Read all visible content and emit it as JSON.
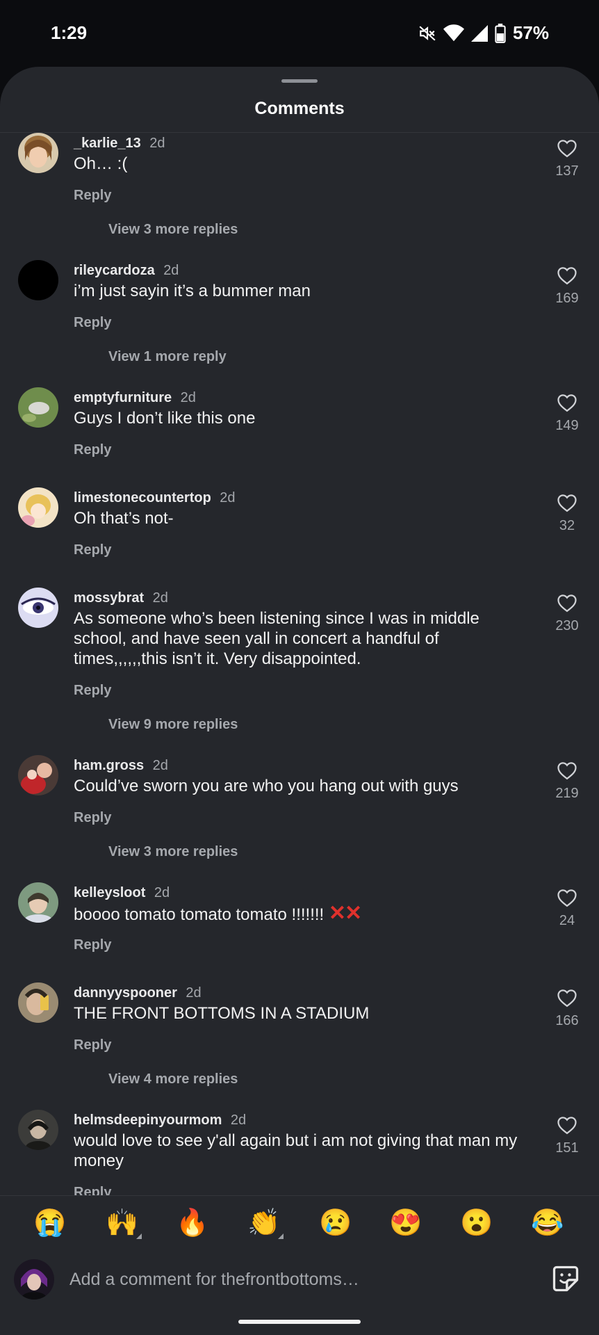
{
  "status_bar": {
    "time": "1:29",
    "battery": "57%"
  },
  "sheet": {
    "title": "Comments"
  },
  "comments": [
    {
      "user": "_karlie_13",
      "time": "2d",
      "text": "Oh… :(",
      "reply_label": "Reply",
      "likes": "137",
      "view_more": "View 3 more replies",
      "avatar_color": "#c7a46b"
    },
    {
      "user": "rileycardoza",
      "time": "2d",
      "text": "i’m just sayin it’s a bummer man",
      "reply_label": "Reply",
      "likes": "169",
      "view_more": "View 1 more reply",
      "avatar_color": "#000000"
    },
    {
      "user": "emptyfurniture",
      "time": "2d",
      "text": "Guys I don’t like this one",
      "reply_label": "Reply",
      "likes": "149",
      "view_more": "",
      "avatar_color": "#7c9a5a"
    },
    {
      "user": "limestonecountertop",
      "time": "2d",
      "text": "Oh that’s not-",
      "reply_label": "Reply",
      "likes": "32",
      "view_more": "",
      "avatar_color": "#e8c98a"
    },
    {
      "user": "mossybrat",
      "time": "2d",
      "text": "As someone who’s been listening since I was in middle school, and have seen yall in concert a handful of times,,,,,,this isn’t it. Very disappointed.",
      "reply_label": "Reply",
      "likes": "230",
      "view_more": "View 9 more replies",
      "avatar_color": "#a9a4d8"
    },
    {
      "user": "ham.gross",
      "time": "2d",
      "text": "Could’ve sworn you are who you hang out with guys",
      "reply_label": "Reply",
      "likes": "219",
      "view_more": "View 3 more replies",
      "avatar_color": "#b8312c"
    },
    {
      "user": "kelleysloot",
      "time": "2d",
      "text": "boooo tomato tomato tomato !!!!!!! ",
      "text_emoji": "✕✕",
      "reply_label": "Reply",
      "likes": "24",
      "view_more": "",
      "avatar_color": "#6d8a6a"
    },
    {
      "user": "dannyyspooner",
      "time": "2d",
      "text": "THE FRONT BOTTOMS IN A STADIUM",
      "reply_label": "Reply",
      "likes": "166",
      "view_more": "View 4 more replies",
      "avatar_color": "#8a7a62"
    },
    {
      "user": "helmsdeepinyourmom",
      "time": "2d",
      "text": "would love to see y'all again but i am not giving that man my money",
      "reply_label": "Reply",
      "likes": "151",
      "view_more": "",
      "avatar_color": "#4a4a48"
    }
  ],
  "emoji_bar": [
    "😭",
    "🙌",
    "🔥",
    "👏",
    "😢",
    "😍",
    "😮",
    "😂"
  ],
  "comment_input": {
    "placeholder": "Add a comment for thefrontbottoms…"
  },
  "colors": {
    "background": "#25272c",
    "muted": "#a5a8ad",
    "text": "#f2f2f2",
    "accent_red": "#e0312c"
  },
  "icons": [
    "heart-icon",
    "sticker-icon",
    "mute-icon",
    "wifi-icon",
    "signal-icon",
    "battery-icon"
  ]
}
